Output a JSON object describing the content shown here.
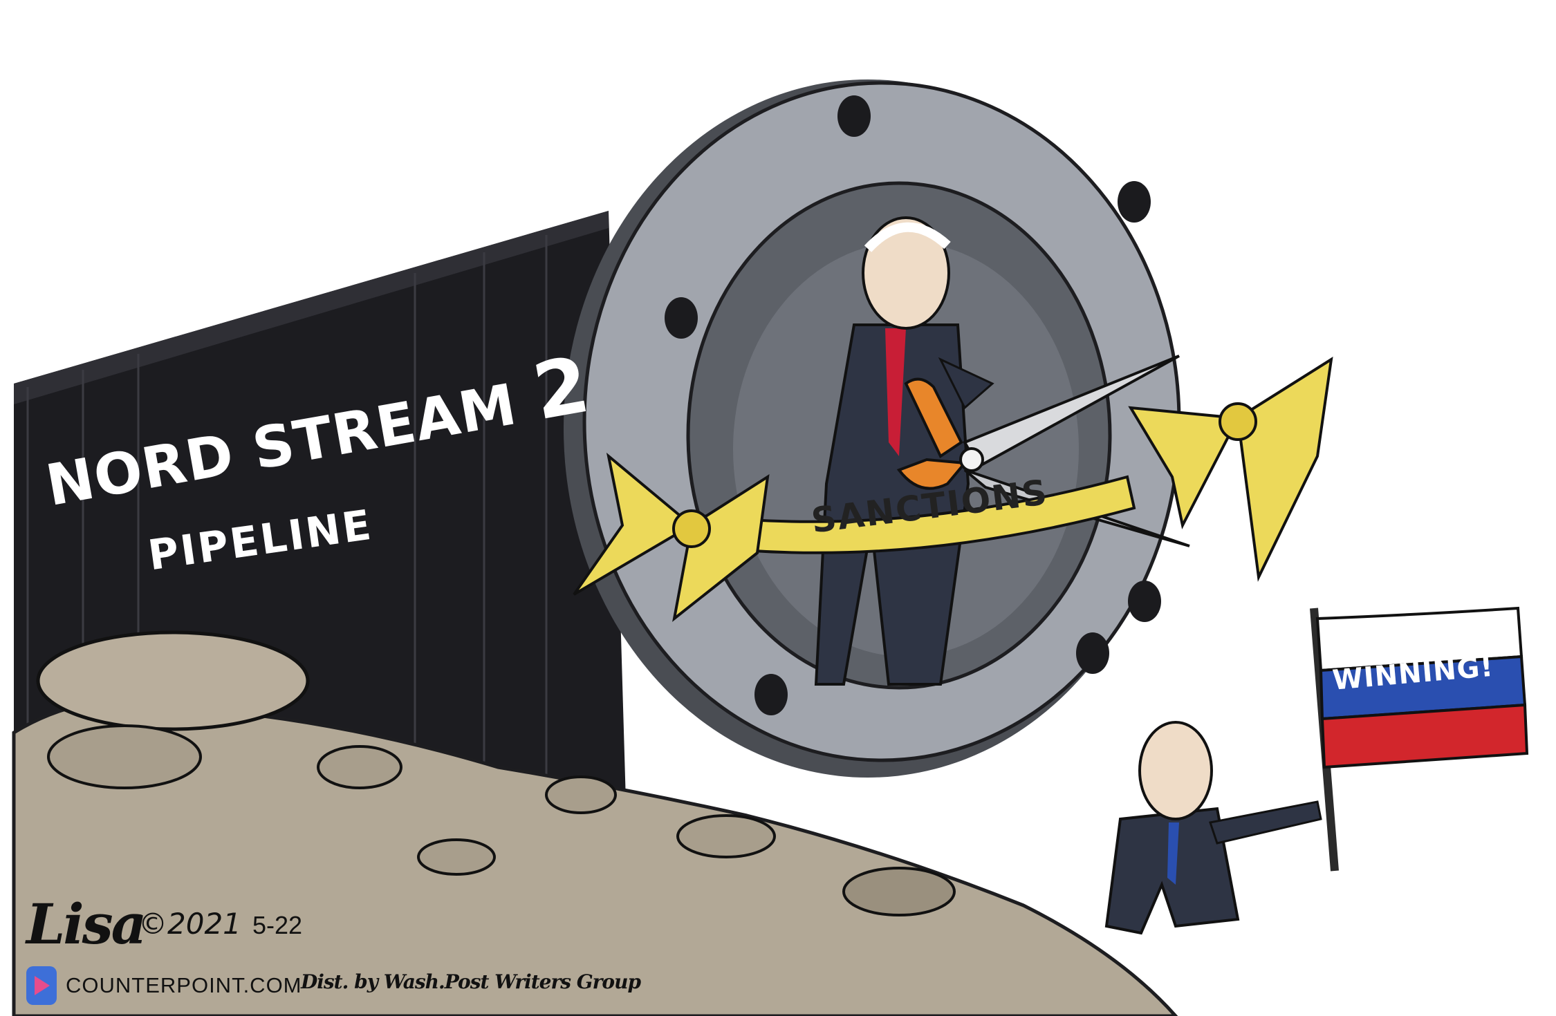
{
  "cartoon": {
    "pipeline_title": "NORD STREAM",
    "pipeline_number": "2",
    "pipeline_subtitle": "PIPELINE",
    "ribbon_text": "SANCTIONS",
    "flag_text": "WINNING!"
  },
  "credits": {
    "signature": "Lisa",
    "copyright": "©2021",
    "date": "5-22",
    "site": "COUNTERPOINT.COM",
    "distributor": "Dist. by Wash.Post Writers Group"
  },
  "colors": {
    "pipe": "#1c1c20",
    "flange": "#9a9ea6",
    "interior": "#5d6168",
    "ribbon": "#ecd95a",
    "scissors_handle": "#e8862a",
    "rocks": "#b2a896",
    "flag_white": "#ffffff",
    "flag_blue": "#2a4fb0",
    "flag_red": "#d2262c",
    "tie": "#c81e36",
    "suit": "#2e3444"
  }
}
